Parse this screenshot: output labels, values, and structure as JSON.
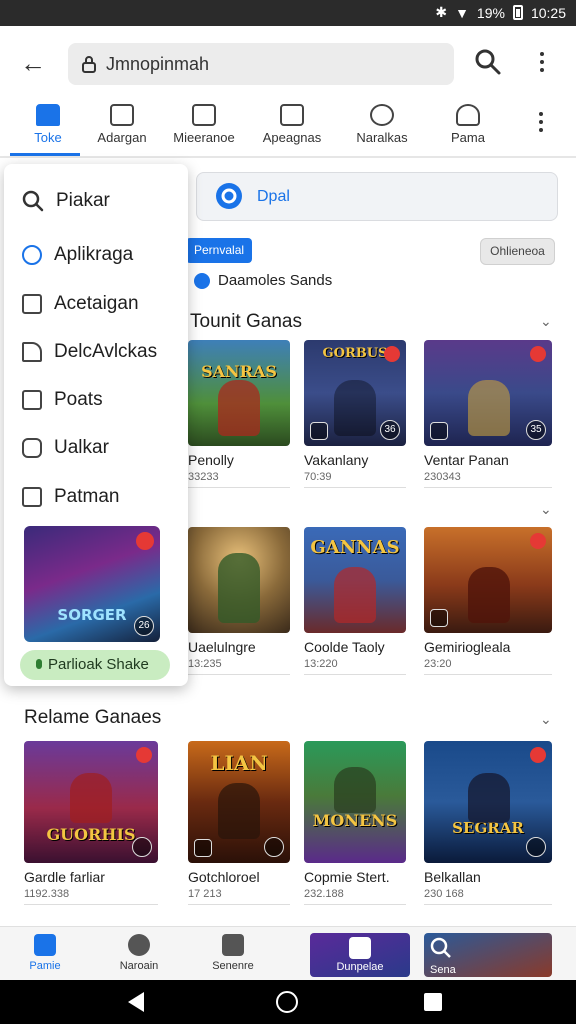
{
  "status_bar": {
    "time": "10:25",
    "battery": "19%"
  },
  "top_bar": {
    "search_text": "Jmnopinmah"
  },
  "tabs": [
    {
      "label": "Toke",
      "icon": "home-icon",
      "active": true
    },
    {
      "label": "Adargan",
      "icon": "gallery-icon"
    },
    {
      "label": "Mieeranoe",
      "icon": "expand-icon"
    },
    {
      "label": "Apeagnas",
      "icon": "edit-icon"
    },
    {
      "label": "Naralkas",
      "icon": "badge-icon"
    },
    {
      "label": "Pama",
      "icon": "person-icon"
    }
  ],
  "drawer": {
    "items": [
      {
        "label": "Piakar",
        "icon": "search-icon"
      },
      {
        "label": "Aplikraga",
        "icon": "refresh-icon"
      },
      {
        "label": "Acetaigan",
        "icon": "document-icon"
      },
      {
        "label": "DelcAvlckas",
        "icon": "shoe-icon"
      },
      {
        "label": "Poats",
        "icon": "check-box-icon"
      },
      {
        "label": "Ualkar",
        "icon": "bag-icon"
      },
      {
        "label": "Patman",
        "icon": "square-icon"
      }
    ],
    "thumb_title": "SORGER",
    "thumb_badge": "26",
    "pill_label": "Parlioak Shake"
  },
  "content": {
    "chip_label": "Dpal",
    "badge_label": "Pernvalal",
    "gray_button": "Ohlieneoa",
    "subtitle": "Daamoles Sands",
    "section1_title": "Tounit Ganas",
    "section3_title": "Relame Ganaes"
  },
  "row1": [
    {
      "name": "Penolly",
      "meta": "33233",
      "title": "SANRAS",
      "badge": ""
    },
    {
      "name": "Vakanlany",
      "meta": "70:39",
      "title": "GORBUS",
      "badge": "36"
    },
    {
      "name": "Ventar Panan",
      "meta": "230343",
      "title": "",
      "badge": "35"
    }
  ],
  "row2": [
    {
      "name": "Uaelulngre",
      "meta": "13:235",
      "title": "",
      "badge": ""
    },
    {
      "name": "Coolde Taoly",
      "meta": "13:220",
      "title": "GANNAS",
      "badge": ""
    },
    {
      "name": "Gemiriogleala",
      "meta": "23:20",
      "title": "",
      "badge": ""
    }
  ],
  "row3": [
    {
      "name": "Gardle farliar",
      "meta": "1192.338",
      "title": "GUORHIS",
      "badge": ""
    },
    {
      "name": "Gotchloroel",
      "meta": "17 213",
      "title": "LIAN",
      "badge": ""
    },
    {
      "name": "Copmie Stert.",
      "meta": "232.188",
      "title": "MONENS",
      "badge": ""
    },
    {
      "name": "Belkallan",
      "meta": "230 168",
      "title": "SEGRAR",
      "badge": ""
    }
  ],
  "bottom_nav": [
    {
      "label": "Pamie",
      "icon": "home-icon",
      "active": true
    },
    {
      "label": "Naroain",
      "icon": "compass-icon"
    },
    {
      "label": "Senenre",
      "icon": "inbox-icon"
    },
    {
      "label": "Dunpelae",
      "icon": "game-icon"
    },
    {
      "label": "Sena",
      "icon": "search-icon"
    }
  ],
  "colors": {
    "accent": "#1a73e8",
    "pill": "#c9ecc1",
    "red_badge": "#e53935"
  }
}
